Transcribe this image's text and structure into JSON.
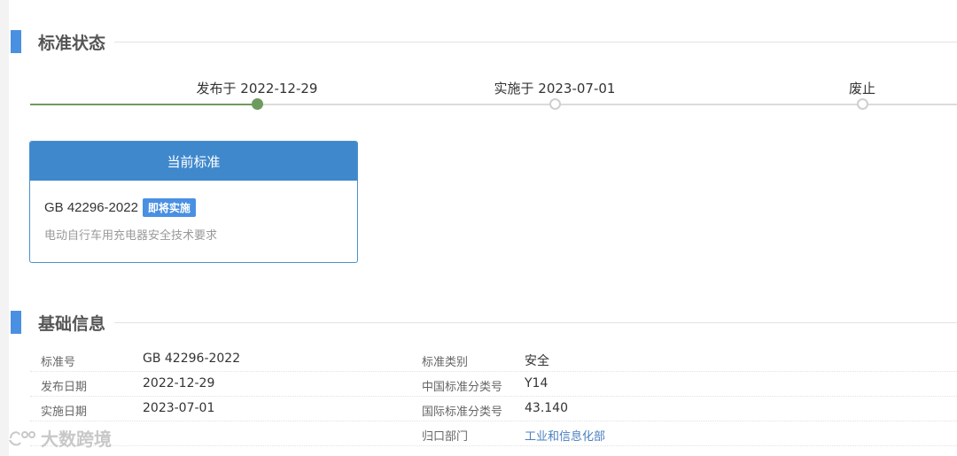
{
  "status_section": {
    "title": "标准状态"
  },
  "timeline": {
    "steps": [
      {
        "label": "发布于 2022-12-29",
        "done": true
      },
      {
        "label": "实施于 2023-07-01",
        "done": false
      },
      {
        "label": "废止",
        "done": false
      }
    ],
    "progress_color": "#6f9a5e"
  },
  "current_card": {
    "header": "当前标准",
    "code": "GB 42296-2022",
    "badge": "即将实施",
    "description": "电动自行车用充电器安全技术要求"
  },
  "basic_section": {
    "title": "基础信息"
  },
  "basic_info": {
    "rows": [
      {
        "left_label": "标准号",
        "left_value": "GB 42296-2022",
        "right_label": "标准类别",
        "right_value": "安全"
      },
      {
        "left_label": "发布日期",
        "left_value": "2022-12-29",
        "right_label": "中国标准分类号",
        "right_value": "Y14"
      },
      {
        "left_label": "实施日期",
        "left_value": "2023-07-01",
        "right_label": "国际标准分类号",
        "right_value": "43.140"
      },
      {
        "left_label": "",
        "left_value": "",
        "right_label": "归口部门",
        "right_value": "工业和信息化部"
      }
    ]
  },
  "watermark": {
    "text": "大数跨境"
  },
  "colors": {
    "accent": "#4a90e2",
    "card_header": "#3f88cc",
    "link": "#4a7fc0"
  }
}
